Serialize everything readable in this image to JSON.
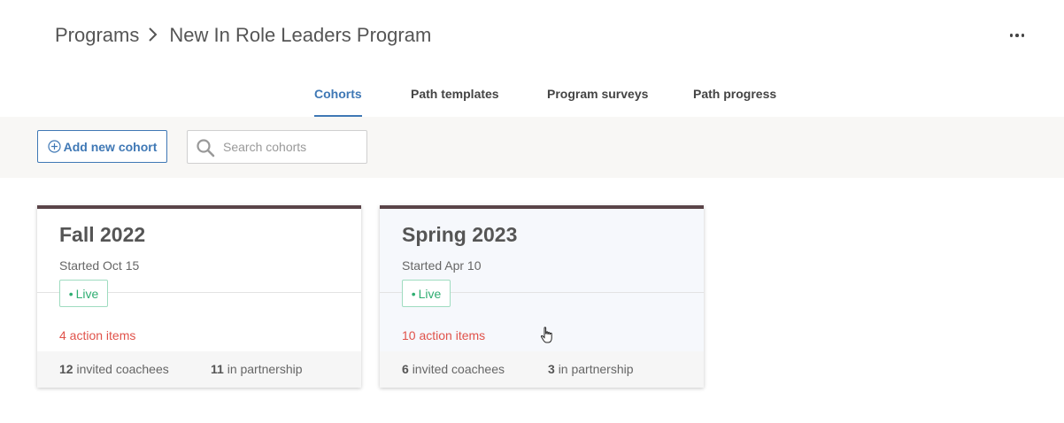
{
  "breadcrumb": {
    "parent": "Programs",
    "current": "New In Role Leaders Program"
  },
  "tabs": [
    {
      "label": "Cohorts",
      "active": true
    },
    {
      "label": "Path templates",
      "active": false
    },
    {
      "label": "Program surveys",
      "active": false
    },
    {
      "label": "Path progress",
      "active": false
    }
  ],
  "toolbar": {
    "add_label": "Add new cohort",
    "search_placeholder": "Search cohorts"
  },
  "cohorts": [
    {
      "title": "Fall 2022",
      "started": "Started Oct 15",
      "status": "Live",
      "action_items": "4 action items",
      "invited_count": "12",
      "invited_label": "invited coachees",
      "partnership_count": "11",
      "partnership_label": "in partnership"
    },
    {
      "title": "Spring 2023",
      "started": "Started Apr 10",
      "status": "Live",
      "action_items": "10 action items",
      "invited_count": "6",
      "invited_label": "invited coachees",
      "partnership_count": "3",
      "partnership_label": "in partnership"
    }
  ],
  "colors": {
    "accent": "#3f78b5",
    "card_top": "#5a4448",
    "live": "#2fae72",
    "alert": "#e0524a"
  }
}
